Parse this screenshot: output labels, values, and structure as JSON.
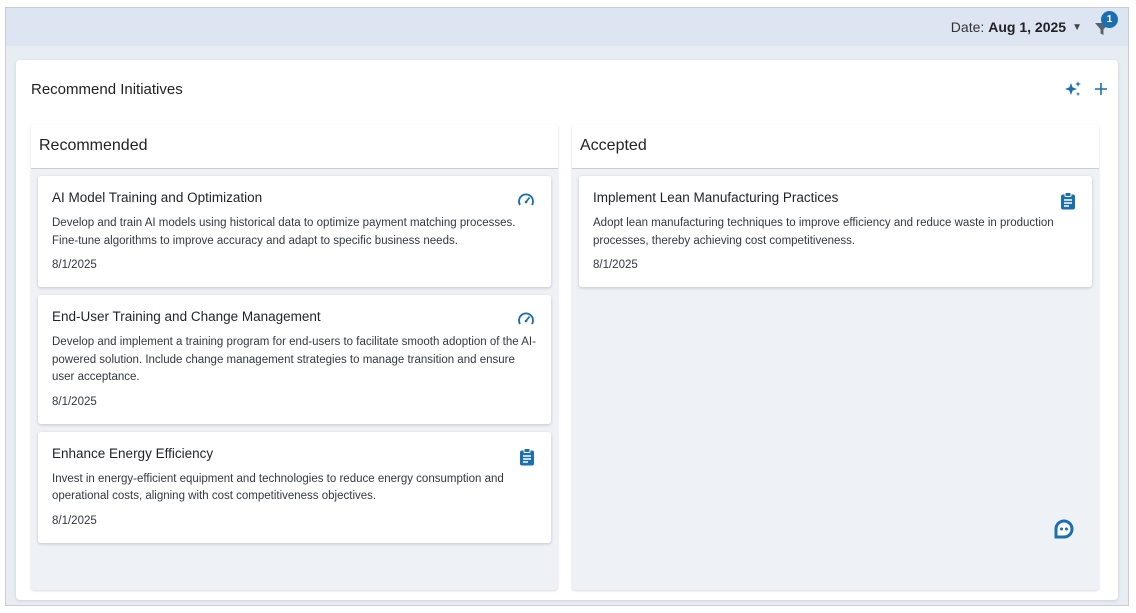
{
  "topbar": {
    "date_label": "Date:",
    "date_value": "Aug 1, 2025",
    "filter_badge": "1"
  },
  "panel": {
    "title": "Recommend Initiatives",
    "ai_icon": "sparkle-icon",
    "add_icon": "plus-icon"
  },
  "columns": {
    "recommended": {
      "title": "Recommended",
      "cards": [
        {
          "title": "AI Model Training and Optimization",
          "description": "Develop and train AI models using historical data to optimize payment matching processes. Fine-tune algorithms to improve accuracy and adapt to specific business needs.",
          "date": "8/1/2025",
          "icon": "speedometer-icon"
        },
        {
          "title": "End-User Training and Change Management",
          "description": "Develop and implement a training program for end-users to facilitate smooth adoption of the AI-powered solution. Include change management strategies to manage transition and ensure user acceptance.",
          "date": "8/1/2025",
          "icon": "speedometer-icon"
        },
        {
          "title": "Enhance Energy Efficiency",
          "description": "Invest in energy-efficient equipment and technologies to reduce energy consumption and operational costs, aligning with cost competitiveness objectives.",
          "date": "8/1/2025",
          "icon": "clipboard-icon"
        }
      ]
    },
    "accepted": {
      "title": "Accepted",
      "cards": [
        {
          "title": "Implement Lean Manufacturing Practices",
          "description": "Adopt lean manufacturing techniques to improve efficiency and reduce waste in production processes, thereby achieving cost competitiveness.",
          "date": "8/1/2025",
          "icon": "clipboard-icon"
        }
      ]
    }
  },
  "colors": {
    "accent": "#1b6fb0",
    "topbar_bg": "#dde5f2",
    "column_bg": "#eef1f6"
  }
}
